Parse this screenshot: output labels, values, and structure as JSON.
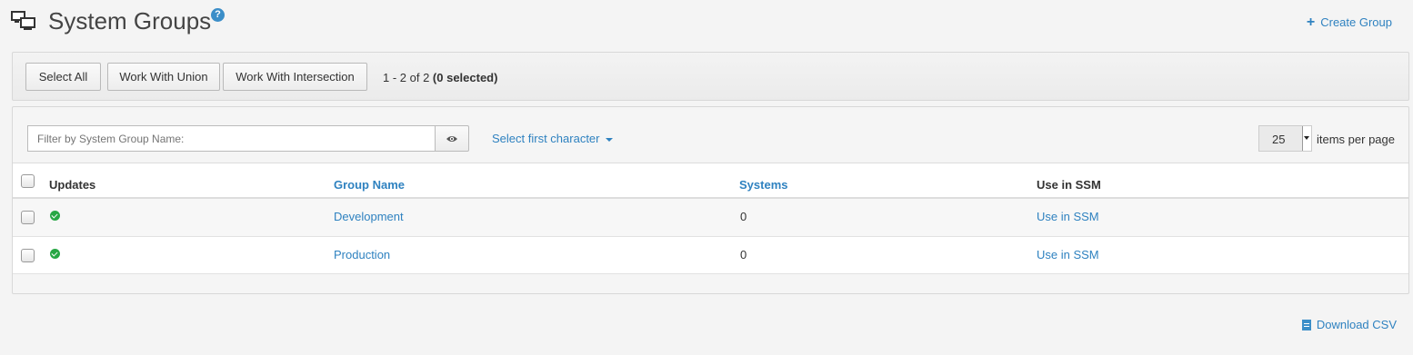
{
  "header": {
    "title": "System Groups",
    "help_icon": "question-circle-icon",
    "create_label": "Create Group"
  },
  "toolbar": {
    "select_all": "Select All",
    "work_union": "Work With Union",
    "work_intersection": "Work With Intersection",
    "count_text": "1 - 2 of 2 ",
    "selected_text": "(0 selected)"
  },
  "filter": {
    "placeholder": "Filter by System Group Name:",
    "first_char": "Select first character",
    "per_page_value": "25",
    "per_page_label": "items per page"
  },
  "table": {
    "columns": [
      "Updates",
      "Group Name",
      "Systems",
      "Use in SSM"
    ],
    "rows": [
      {
        "status": "ok",
        "name": "Development",
        "systems": "0",
        "ssm": "Use in SSM"
      },
      {
        "status": "ok",
        "name": "Production",
        "systems": "0",
        "ssm": "Use in SSM"
      }
    ]
  },
  "footer": {
    "download": "Download CSV"
  },
  "colors": {
    "link": "#2f82c0",
    "status_ok": "#28a745"
  }
}
